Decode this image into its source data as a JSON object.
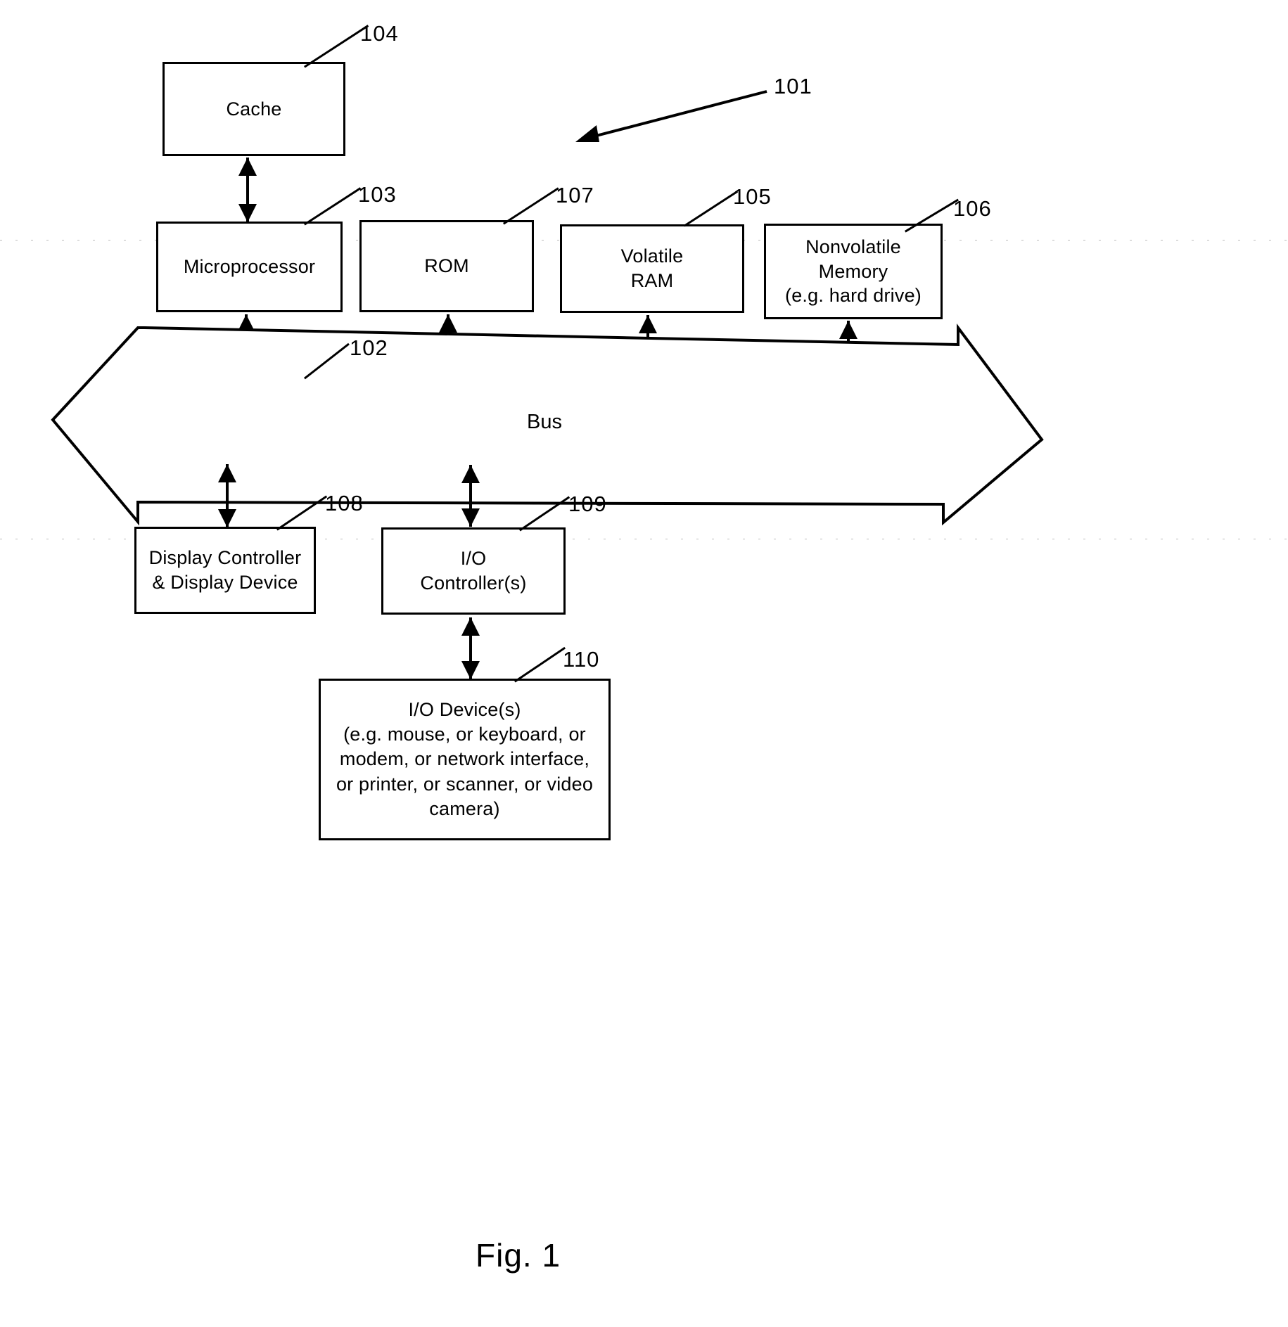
{
  "figure": {
    "caption": "Fig. 1",
    "overall_ref": "101",
    "type": "patent-block-diagram"
  },
  "blocks": [
    {
      "id": "cache",
      "label": "Cache",
      "ref": "104"
    },
    {
      "id": "microprocessor",
      "label": "Microprocessor",
      "ref": "103"
    },
    {
      "id": "rom",
      "label": "ROM",
      "ref": "107"
    },
    {
      "id": "volatile_ram",
      "label": "Volatile\nRAM",
      "ref": "105"
    },
    {
      "id": "nonvolatile",
      "label": "Nonvolatile\nMemory\n(e.g. hard drive)",
      "ref": "106"
    },
    {
      "id": "bus",
      "label": "Bus",
      "ref": "102"
    },
    {
      "id": "display",
      "label": "Display Controller\n& Display Device",
      "ref": "108"
    },
    {
      "id": "io_controller",
      "label": "I/O\nController(s)",
      "ref": "109"
    },
    {
      "id": "io_devices",
      "label": "I/O Device(s)\n(e.g. mouse, or keyboard, or\nmodem, or network interface,\nor printer, or scanner, or video\ncamera)",
      "ref": "110"
    }
  ],
  "connections": [
    {
      "from": "cache",
      "to": "microprocessor",
      "kind": "double-arrow"
    },
    {
      "from": "microprocessor",
      "to": "bus",
      "kind": "double-arrow"
    },
    {
      "from": "rom",
      "to": "bus",
      "kind": "double-arrow"
    },
    {
      "from": "volatile_ram",
      "to": "bus",
      "kind": "double-arrow"
    },
    {
      "from": "nonvolatile",
      "to": "bus",
      "kind": "double-arrow"
    },
    {
      "from": "bus",
      "to": "display",
      "kind": "double-arrow"
    },
    {
      "from": "bus",
      "to": "io_controller",
      "kind": "double-arrow"
    },
    {
      "from": "io_controller",
      "to": "io_devices",
      "kind": "double-arrow"
    }
  ],
  "colors": {
    "ink": "#000000",
    "paper": "#ffffff",
    "scan_artifact": "#bdbdbd"
  }
}
